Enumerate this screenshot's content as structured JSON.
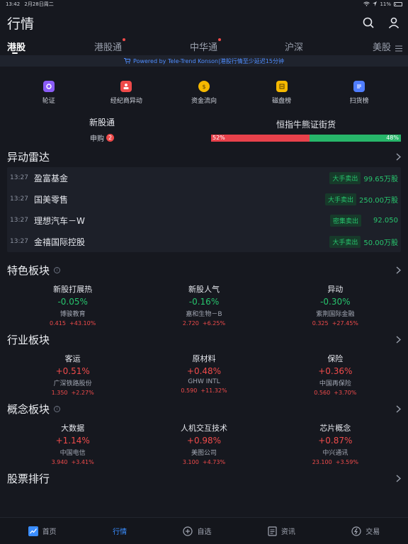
{
  "status": {
    "time": "13:42",
    "date": "2月28日周二",
    "battery": "11%"
  },
  "header": {
    "title": "行情"
  },
  "tabs": [
    {
      "label": "港股",
      "active": true,
      "dot": false
    },
    {
      "label": "港股通",
      "active": false,
      "dot": true
    },
    {
      "label": "中华通",
      "active": false,
      "dot": true
    },
    {
      "label": "沪深",
      "active": false,
      "dot": false
    },
    {
      "label": "美股",
      "active": false,
      "dot": false
    }
  ],
  "powered": "Powered by Tele-Trend Konson|港股行情至少延迟15分钟",
  "tools": [
    {
      "label": "轮证",
      "icon": "warrant-icon",
      "color": "#8a5cf6"
    },
    {
      "label": "经纪商异动",
      "icon": "broker-icon",
      "color": "#ef4a4a"
    },
    {
      "label": "资金流向",
      "icon": "money-bag-icon",
      "color": "#f5b800"
    },
    {
      "label": "磁盘榜",
      "icon": "board-icon",
      "color": "#f5b800"
    },
    {
      "label": "扫货榜",
      "icon": "scan-list-icon",
      "color": "#4f7dff"
    }
  ],
  "ipo": {
    "title": "新股通",
    "sub": "申购",
    "count": "2"
  },
  "bullbear": {
    "title": "恒指牛熊证街货",
    "bull": "52%",
    "bear": "48%",
    "bull_frac": 0.52
  },
  "radar": {
    "title": "异动雷达",
    "rows": [
      {
        "time": "13:27",
        "name": "盈富基金",
        "tag": "大手卖出",
        "val": "99.65万股"
      },
      {
        "time": "13:27",
        "name": "国美零售",
        "tag": "大手卖出",
        "val": "250.00万股"
      },
      {
        "time": "13:27",
        "name": "理想汽车－W",
        "tag": "密集卖出",
        "val": "92.050"
      },
      {
        "time": "13:27",
        "name": "金禧国际控股",
        "tag": "大手卖出",
        "val": "50.00万股"
      }
    ]
  },
  "special": {
    "title": "特色板块",
    "items": [
      {
        "name": "新股打展热",
        "pct": "-0.05%",
        "stock": "博骏教育",
        "price": "0.415",
        "chg": "+43.10%",
        "up": false
      },
      {
        "name": "新股人气",
        "pct": "-0.16%",
        "stock": "嘉和生物－B",
        "price": "2.720",
        "chg": "+6.25%",
        "up": false
      },
      {
        "name": "异动",
        "pct": "-0.30%",
        "stock": "紫荆国际金融",
        "price": "0.325",
        "chg": "+27.45%",
        "up": false
      }
    ]
  },
  "industry": {
    "title": "行业板块",
    "items": [
      {
        "name": "客运",
        "pct": "+0.51%",
        "stock": "广深铁路股份",
        "price": "1.350",
        "chg": "+2.27%",
        "up": true
      },
      {
        "name": "原材料",
        "pct": "+0.48%",
        "stock": "GHW INTL",
        "price": "0.590",
        "chg": "+11.32%",
        "up": true
      },
      {
        "name": "保险",
        "pct": "+0.36%",
        "stock": "中国再保险",
        "price": "0.560",
        "chg": "+3.70%",
        "up": true
      }
    ]
  },
  "concept": {
    "title": "概念板块",
    "items": [
      {
        "name": "大数据",
        "pct": "+1.14%",
        "stock": "中国电信",
        "price": "3.940",
        "chg": "+3.41%",
        "up": true
      },
      {
        "name": "人机交互技术",
        "pct": "+0.98%",
        "stock": "美图公司",
        "price": "3.100",
        "chg": "+4.73%",
        "up": true
      },
      {
        "name": "芯片概念",
        "pct": "+0.87%",
        "stock": "中兴通讯",
        "price": "23.100",
        "chg": "+3.59%",
        "up": true
      }
    ]
  },
  "ranking": {
    "title": "股票排行"
  },
  "nav": [
    {
      "label": "首页",
      "icon": "home-chart-icon",
      "active": false
    },
    {
      "label": "行情",
      "icon": "",
      "active": true
    },
    {
      "label": "自选",
      "icon": "add-circle-icon",
      "active": false
    },
    {
      "label": "资讯",
      "icon": "news-icon",
      "active": false
    },
    {
      "label": "交易",
      "icon": "trade-icon",
      "active": false
    }
  ]
}
